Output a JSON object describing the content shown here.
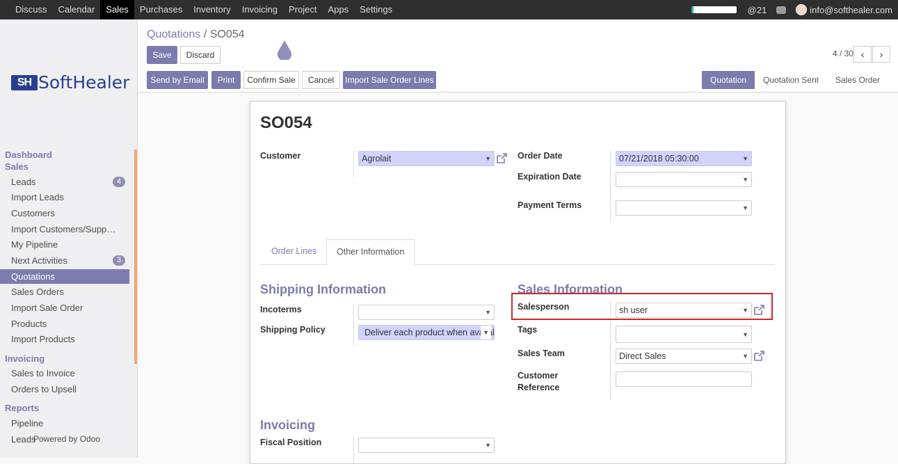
{
  "navbar": {
    "menu": [
      "Discuss",
      "Calendar",
      "Sales",
      "Purchases",
      "Inventory",
      "Invoicing",
      "Project",
      "Apps",
      "Settings"
    ],
    "active_menu": "Sales",
    "mentions": "21",
    "user_email": "info@softhealer.com"
  },
  "logo": {
    "mark": "SH",
    "text": "SoftHealer"
  },
  "sidebar": {
    "dashboard": "Dashboard",
    "sales_section": "Sales",
    "sales_items": [
      {
        "label": "Leads",
        "badge": "4"
      },
      {
        "label": "Import Leads"
      },
      {
        "label": "Customers"
      },
      {
        "label": "Import Customers/Supp…"
      },
      {
        "label": "My Pipeline"
      },
      {
        "label": "Next Activities",
        "badge": "3"
      },
      {
        "label": "Quotations",
        "selected": true
      },
      {
        "label": "Sales Orders"
      },
      {
        "label": "Import Sale Order"
      },
      {
        "label": "Products"
      },
      {
        "label": "Import Products"
      }
    ],
    "invoicing_section": "Invoicing",
    "invoicing_items": [
      {
        "label": "Sales to Invoice"
      },
      {
        "label": "Orders to Upsell"
      }
    ],
    "reports_section": "Reports",
    "reports_items": [
      {
        "label": "Pipeline"
      },
      {
        "label": "Leads"
      }
    ],
    "powered_by": "Powered by Odoo"
  },
  "breadcrumb": {
    "parent": "Quotations",
    "separator": "/",
    "current": "SO054"
  },
  "buttons": {
    "save": "Save",
    "discard": "Discard"
  },
  "pager": {
    "value": "4 / 30",
    "prev": "‹",
    "next": "›"
  },
  "actions": {
    "send_email": "Send by Email",
    "print": "Print",
    "confirm": "Confirm Sale",
    "cancel": "Cancel",
    "import_lines": "Import Sale Order Lines"
  },
  "status": {
    "steps": [
      "Quotation",
      "Quotation Sent",
      "Sales Order"
    ],
    "active": "Quotation"
  },
  "form": {
    "name": "SO054",
    "customer_label": "Customer",
    "customer_value": "Agrolait",
    "order_date_label": "Order Date",
    "order_date_value": "07/21/2018 05:30:00",
    "expiration_label": "Expiration Date",
    "expiration_value": "",
    "payment_terms_label": "Payment Terms",
    "payment_terms_value": ""
  },
  "tabs": {
    "order_lines": "Order Lines",
    "other_info": "Other Information",
    "active": "Other Information"
  },
  "shipping": {
    "heading": "Shipping Information",
    "incoterms_label": "Incoterms",
    "incoterms_value": "",
    "policy_label": "Shipping Policy",
    "policy_value": "Deliver each product when available"
  },
  "sales_info": {
    "heading": "Sales Information",
    "salesperson_label": "Salesperson",
    "salesperson_value": "sh user",
    "tags_label": "Tags",
    "tags_value": "",
    "team_label": "Sales Team",
    "team_value": "Direct Sales",
    "customer_ref_label_1": "Customer",
    "customer_ref_label_2": "Reference",
    "customer_ref_value": ""
  },
  "invoicing": {
    "heading": "Invoicing",
    "fiscal_label": "Fiscal Position",
    "fiscal_value": ""
  },
  "colors": {
    "brand": "#7c7bad",
    "navbar": "#2f2f2f",
    "required": "#d2d2ff",
    "highlight": "#d0262b"
  }
}
